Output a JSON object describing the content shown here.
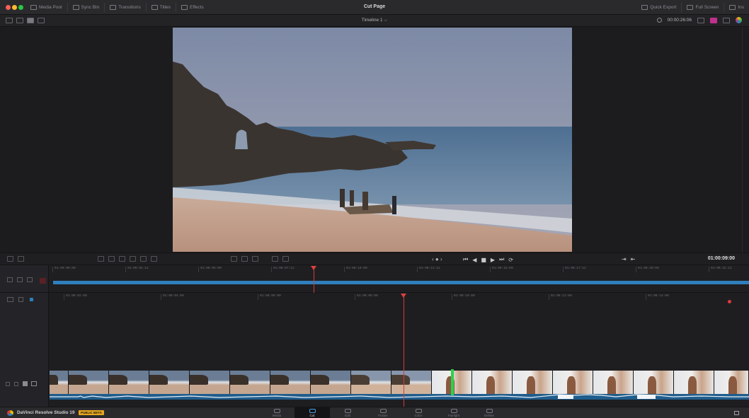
{
  "titlebar": {
    "page_title": "Cut Page",
    "tools": [
      {
        "label": "Media Pool",
        "icon": "media-pool-icon"
      },
      {
        "label": "Sync Bin",
        "icon": "sync-bin-icon"
      },
      {
        "label": "Transitions",
        "icon": "transitions-icon"
      },
      {
        "label": "Titles",
        "icon": "titles-icon"
      },
      {
        "label": "Effects",
        "icon": "effects-icon"
      }
    ],
    "right_tools": [
      {
        "label": "Quick Export",
        "icon": "quick-export-icon"
      },
      {
        "label": "Full Screen",
        "icon": "full-screen-icon"
      },
      {
        "label": "Ins",
        "icon": "inspector-icon"
      }
    ],
    "traffic_colors": [
      "#ff5f57",
      "#febc2e",
      "#28c840"
    ]
  },
  "subbar": {
    "timeline_name": "Timeline 1 ⌵",
    "duration": "00:00:26:06"
  },
  "transport": {
    "nav": "‹ ● ›",
    "buttons": [
      "⏮",
      "◀",
      "■",
      "▶",
      "⏭",
      "⟳"
    ],
    "timecode": "01:00:09:00"
  },
  "upper_ruler": [
    "01:00:00:00",
    "01:00:02:12",
    "01:00:05:00",
    "01:00:07:12",
    "01:00:10:00",
    "01:00:12:12",
    "01:00:15:00",
    "01:00:17:12",
    "01:00:20:00",
    "01:00:22:12"
  ],
  "lower_ruler": [
    "01:00:02:00",
    "01:00:04:00",
    "01:00:06:00",
    "01:00:08:00",
    "01:00:10:00",
    "01:00:12:00",
    "01:00:14:00"
  ],
  "bottombar": {
    "app_name": "DaVinci Resolve Studio 19",
    "badge": "PUBLIC BETA",
    "tabs": [
      {
        "label": "Media",
        "icon": "media-icon",
        "active": false
      },
      {
        "label": "Cut",
        "icon": "cut-icon",
        "active": true
      },
      {
        "label": "Edit",
        "icon": "edit-icon",
        "active": false
      },
      {
        "label": "Fusion",
        "icon": "fusion-icon",
        "active": false
      },
      {
        "label": "Color",
        "icon": "color-icon",
        "active": false
      },
      {
        "label": "Fairlight",
        "icon": "fairlight-icon",
        "active": false
      },
      {
        "label": "Deliver",
        "icon": "deliver-icon",
        "active": false
      }
    ]
  },
  "colors": {
    "accent_blue": "#2f7fbd",
    "playhead_red": "#e04040",
    "marker_green": "#2bd24a",
    "badge_orange": "#e6a61c"
  }
}
